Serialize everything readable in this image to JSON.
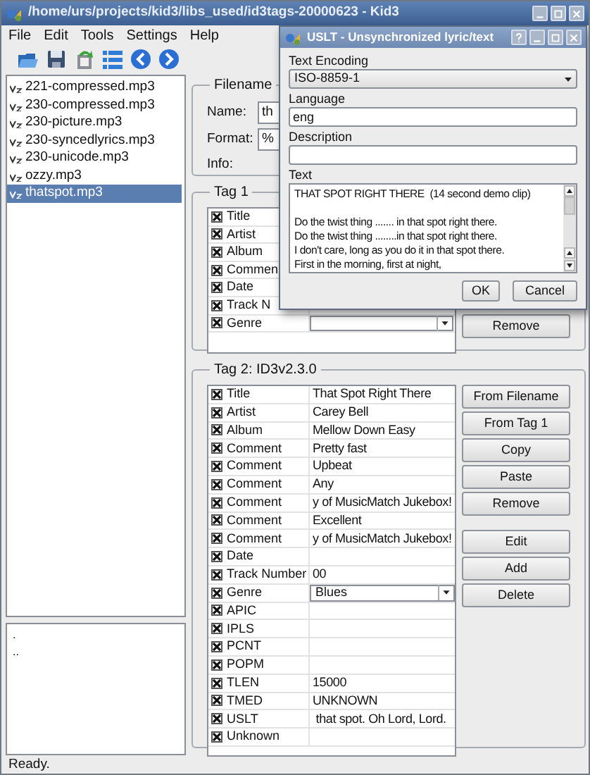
{
  "window": {
    "title": "/home/urs/projects/kid3/libs_used/id3tags-20000623 - Kid3"
  },
  "menu": [
    "File",
    "Edit",
    "Tools",
    "Settings",
    "Help"
  ],
  "files": [
    {
      "name": "221-compressed.mp3",
      "selected": false
    },
    {
      "name": "230-compressed.mp3",
      "selected": false
    },
    {
      "name": "230-picture.mp3",
      "selected": false
    },
    {
      "name": "230-syncedlyrics.mp3",
      "selected": false
    },
    {
      "name": "230-unicode.mp3",
      "selected": false
    },
    {
      "name": "ozzy.mp3",
      "selected": false
    },
    {
      "name": "thatspot.mp3",
      "selected": true
    }
  ],
  "dirs": [
    ".",
    ".."
  ],
  "filename_group": {
    "title": "Filename",
    "name": {
      "label": "Name:",
      "value": "th"
    },
    "format": {
      "label": "Format:",
      "value": "%"
    },
    "info": {
      "label": "Info:"
    }
  },
  "tag1": {
    "title": "Tag 1",
    "frames": [
      {
        "name": "Title",
        "checked": true,
        "kind": "text"
      },
      {
        "name": "Artist",
        "checked": true,
        "kind": "text"
      },
      {
        "name": "Album",
        "checked": true,
        "kind": "text"
      },
      {
        "name": "Commen",
        "checked": true,
        "kind": "text"
      },
      {
        "name": "Date",
        "checked": true,
        "kind": "text"
      },
      {
        "name": "Track N",
        "checked": true,
        "kind": "text"
      },
      {
        "name": "Genre",
        "checked": true,
        "kind": "combo"
      }
    ],
    "buttons": [
      "Remove"
    ]
  },
  "tag2": {
    "title": "Tag 2: ID3v2.3.0",
    "frames": [
      {
        "name": "Title",
        "value": "That Spot Right There",
        "checked": true,
        "kind": "text"
      },
      {
        "name": "Artist",
        "value": "Carey Bell",
        "checked": true,
        "kind": "text"
      },
      {
        "name": "Album",
        "value": "Mellow Down Easy",
        "checked": true,
        "kind": "text"
      },
      {
        "name": "Comment",
        "value": "Pretty fast",
        "checked": true,
        "kind": "text"
      },
      {
        "name": "Comment",
        "value": "Upbeat",
        "checked": true,
        "kind": "text"
      },
      {
        "name": "Comment",
        "value": "Any",
        "checked": true,
        "kind": "text"
      },
      {
        "name": "Comment",
        "value": "y of MusicMatch Jukebox!",
        "checked": true,
        "kind": "text"
      },
      {
        "name": "Comment",
        "value": "Excellent",
        "checked": true,
        "kind": "text"
      },
      {
        "name": "Comment",
        "value": "y of MusicMatch Jukebox!",
        "checked": true,
        "kind": "text"
      },
      {
        "name": "Date",
        "checked": true,
        "kind": "text"
      },
      {
        "name": "Track Number",
        "value": "00",
        "checked": true,
        "kind": "text"
      },
      {
        "name": "Genre",
        "value": "Blues",
        "checked": true,
        "kind": "combo"
      },
      {
        "name": "APIC",
        "checked": true,
        "kind": "text"
      },
      {
        "name": "IPLS",
        "checked": true,
        "kind": "text"
      },
      {
        "name": "PCNT",
        "checked": true,
        "kind": "text"
      },
      {
        "name": "POPM",
        "checked": true,
        "kind": "text"
      },
      {
        "name": "TLEN",
        "value": "15000",
        "checked": true,
        "kind": "text"
      },
      {
        "name": "TMED",
        "value": "UNKNOWN",
        "checked": true,
        "kind": "text"
      },
      {
        "name": "USLT",
        "value": " that spot. Oh Lord, Lord.",
        "checked": true,
        "kind": "text"
      },
      {
        "name": "Unknown",
        "checked": true,
        "kind": "text"
      }
    ],
    "buttons": [
      "From Filename",
      "From Tag 1",
      "Copy",
      "Paste",
      "Remove"
    ],
    "frame_buttons": [
      "Edit",
      "Add",
      "Delete"
    ]
  },
  "dialog": {
    "title": "USLT - Unsynchronized lyric/text",
    "encoding": {
      "label": "Text Encoding",
      "value": "ISO-8859-1"
    },
    "language": {
      "label": "Language",
      "value": "eng"
    },
    "description": {
      "label": "Description"
    },
    "text": {
      "label": "Text",
      "value": "THAT SPOT RIGHT THERE  (14 second demo clip)\n\nDo the twist thing ....... in that spot right there.\nDo the twist thing ........in that spot right there.\nI don't care, long as you do it in that spot there.\nFirst in the morning, first at night,"
    },
    "buttons": [
      "OK",
      "Cancel"
    ]
  },
  "status": "Ready."
}
